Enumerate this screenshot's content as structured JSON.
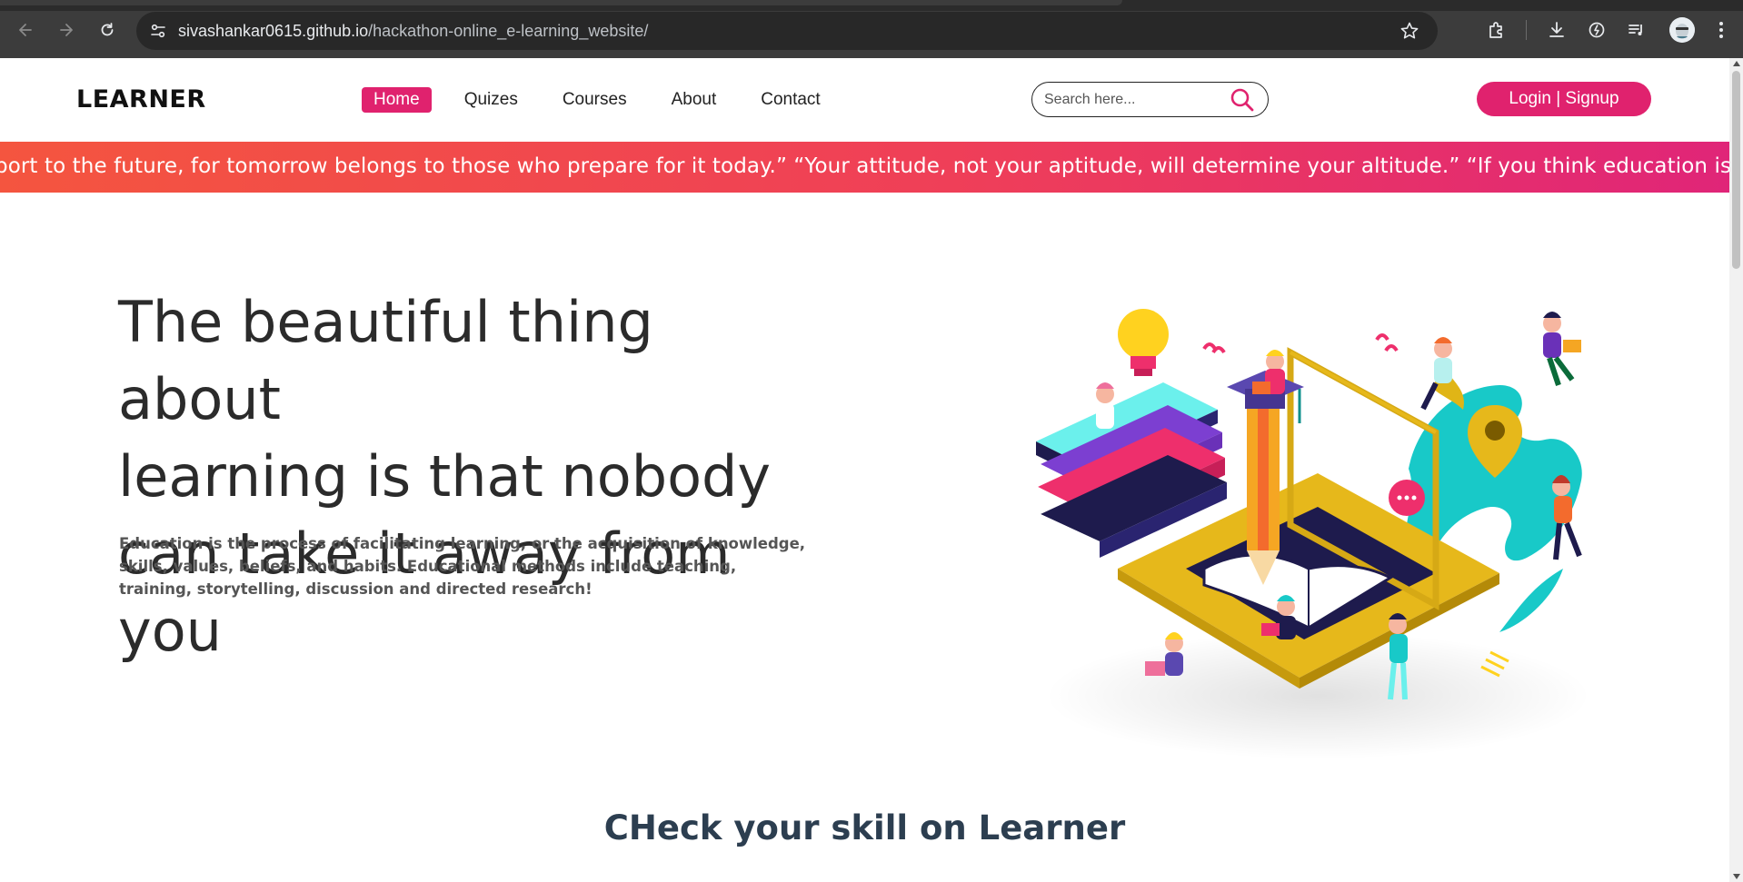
{
  "browser": {
    "url_host": "sivashankar0615.github.io",
    "url_path": "/hackathon-online_e-learning_website/",
    "icons": [
      "back-icon",
      "forward-icon",
      "reload-icon",
      "site-settings-icon",
      "bookmark-star-icon",
      "extensions-icon",
      "download-icon",
      "performance-icon",
      "media-controls-icon",
      "profile-avatar",
      "menu-icon"
    ]
  },
  "header": {
    "logo": "LEARNER",
    "nav": [
      {
        "label": "Home",
        "active": true
      },
      {
        "label": "Quizes",
        "active": false
      },
      {
        "label": "Courses",
        "active": false
      },
      {
        "label": "About",
        "active": false
      },
      {
        "label": "Contact",
        "active": false
      }
    ],
    "search_placeholder": "Search here...",
    "login_label": "Login | Signup"
  },
  "marquee": {
    "text": "port to the future, for tomorrow belongs to those who prepare for it today.” “Your attitude, not your aptitude, will determine your altitude.” “If you think education is"
  },
  "hero": {
    "title_line1": "The beautiful thing about",
    "title_line2": "learning is that nobody",
    "title_line3": "can take it away from you",
    "description": "Education is the process of facilitating learning, or the acquisition of knowledge, skills, values, beliefs, and habits. Educational methods include teaching, training, storytelling, discussion and directed research!"
  },
  "section": {
    "title": "CHeck your skill on Learner"
  },
  "colors": {
    "accent": "#e0226e",
    "marquee_start": "#f4553f",
    "marquee_end": "#e02578",
    "chrome_bg": "#3c3c3c"
  }
}
